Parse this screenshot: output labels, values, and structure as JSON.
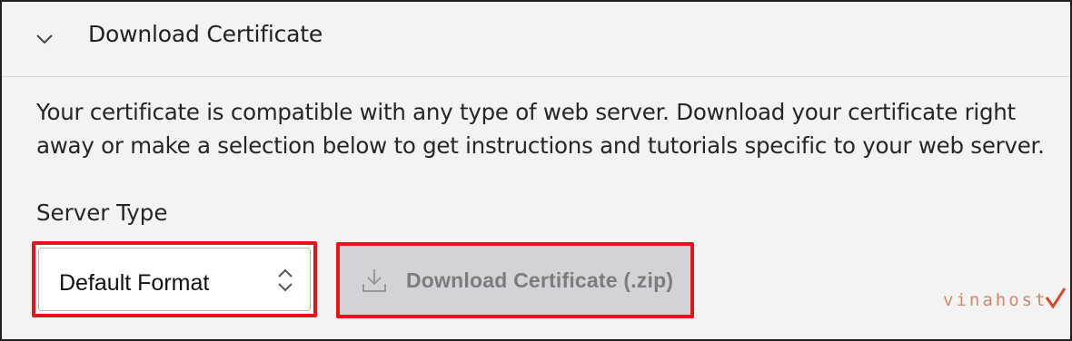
{
  "section": {
    "title": "Download Certificate",
    "description": "Your certificate is compatible with any type of web server. Download your certificate right away or make a selection below to get instructions and tutorials specific to your web server.",
    "collapse_icon": "chevron-down-icon"
  },
  "server_type": {
    "label": "Server Type",
    "selected_value": "Default Format",
    "selector_icon": "up-down-chevron-icon"
  },
  "download_button": {
    "label": "Download Certificate (.zip)",
    "icon": "download-icon"
  },
  "watermark": {
    "text": "vinahost"
  },
  "colors": {
    "panel_bg": "#f3f3f3",
    "highlight_border": "#e8121c",
    "button_disabled_bg": "#d1d3d6",
    "button_disabled_text": "#7c7c7c",
    "watermark": "#c98b6a"
  }
}
